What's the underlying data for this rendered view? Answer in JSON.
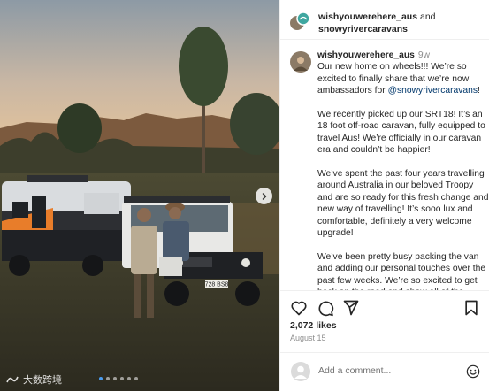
{
  "post": {
    "header_user": "wishyouwerehere_aus",
    "header_and": "and",
    "header_collab": "snowyrivercaravans",
    "caption_user": "wishyouwerehere_aus",
    "caption_time": "9w",
    "caption_p1_a": "Our new home on wheels!!! We’re so excited to finally share that we’re now ambassadors for ",
    "caption_p1_mention": "@snowyrivercaravans",
    "caption_p1_b": "!",
    "caption_p2": "We recently picked up our SRT18! It’s an 18 foot off-road caravan, fully equipped to travel Aus! We’re officially in our caravan era and couldn’t be happier!",
    "caption_p3": "We’ve spent the past four years travelling around Australia in our beloved Troopy and are so ready for this fresh change and new way of travelling! It’s sooo lux and comfortable, definitely a very welcome upgrade!",
    "caption_p4": "We’ve been pretty busy packing the van and adding our personal touches over the past few weeks. We’re so excited to get back on the road and show all of the",
    "likes": "2,072 likes",
    "date": "August 15",
    "comment_placeholder": "Add a comment..."
  },
  "photo": {
    "plate": "728 BS8",
    "watermark": "大数跨境",
    "carousel_dots": 6,
    "active_dot": 0
  },
  "icons": {
    "next": "chevron-right-icon",
    "like": "heart-icon",
    "comment": "comment-bubble-icon",
    "share": "paper-plane-icon",
    "save": "bookmark-icon",
    "emoji": "smiley-icon"
  },
  "colors": {
    "mention": "#00376b",
    "muted": "#8e8e8e",
    "active_dot": "#4a9cf0"
  }
}
